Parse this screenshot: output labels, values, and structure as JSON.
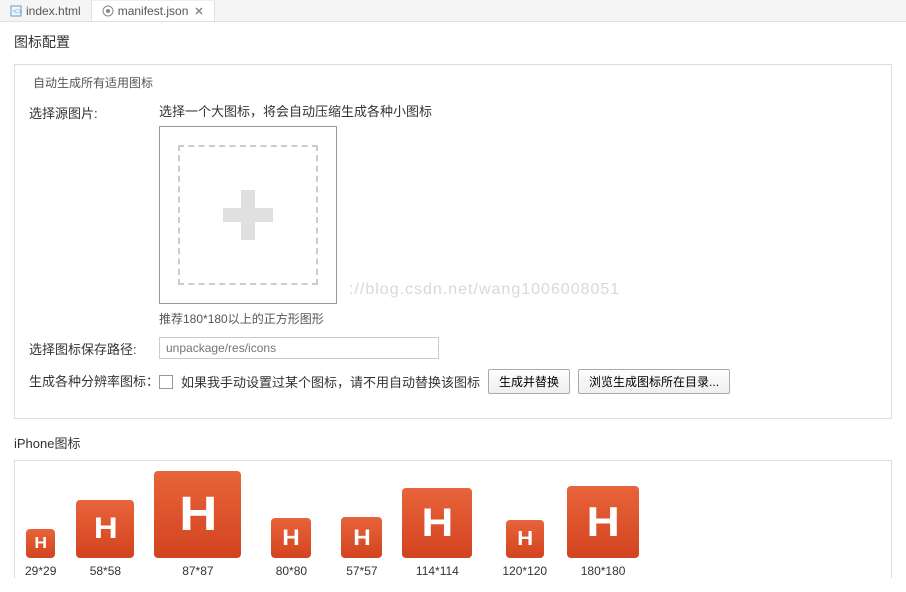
{
  "tabs": [
    {
      "label": "index.html",
      "icon": "html"
    },
    {
      "label": "manifest.json",
      "icon": "json",
      "active": true,
      "closable": true
    }
  ],
  "section_title": "图标配置",
  "panel": {
    "title": "自动生成所有适用图标",
    "source_label": "选择源图片:",
    "source_hint": "选择一个大图标，将会自动压缩生成各种小图标",
    "recommend": "推荐180*180以上的正方形图形",
    "save_path_label": "选择图标保存路径:",
    "save_path_placeholder": "unpackage/res/icons",
    "gen_label": "生成各种分辨率图标：",
    "checkbox_text": "如果我手动设置过某个图标，请不用自动替换该图标",
    "gen_btn": "生成并替换",
    "browse_btn": "浏览生成图标所在目录..."
  },
  "watermark": "://blog.csdn.net/wang1006008051",
  "iphone": {
    "title": "iPhone图标",
    "items": [
      {
        "size": "29*29",
        "css": "size-29"
      },
      {
        "size": "58*58",
        "css": "size-58"
      },
      {
        "size": "87*87",
        "css": "size-87"
      },
      {
        "size": "80*80",
        "css": "size-40"
      },
      {
        "size": "57*57",
        "css": "size-57"
      },
      {
        "size": "114*114",
        "css": "size-80"
      },
      {
        "size": "120*120",
        "css": "size-120"
      },
      {
        "size": "180*180",
        "css": "size-180"
      }
    ]
  }
}
